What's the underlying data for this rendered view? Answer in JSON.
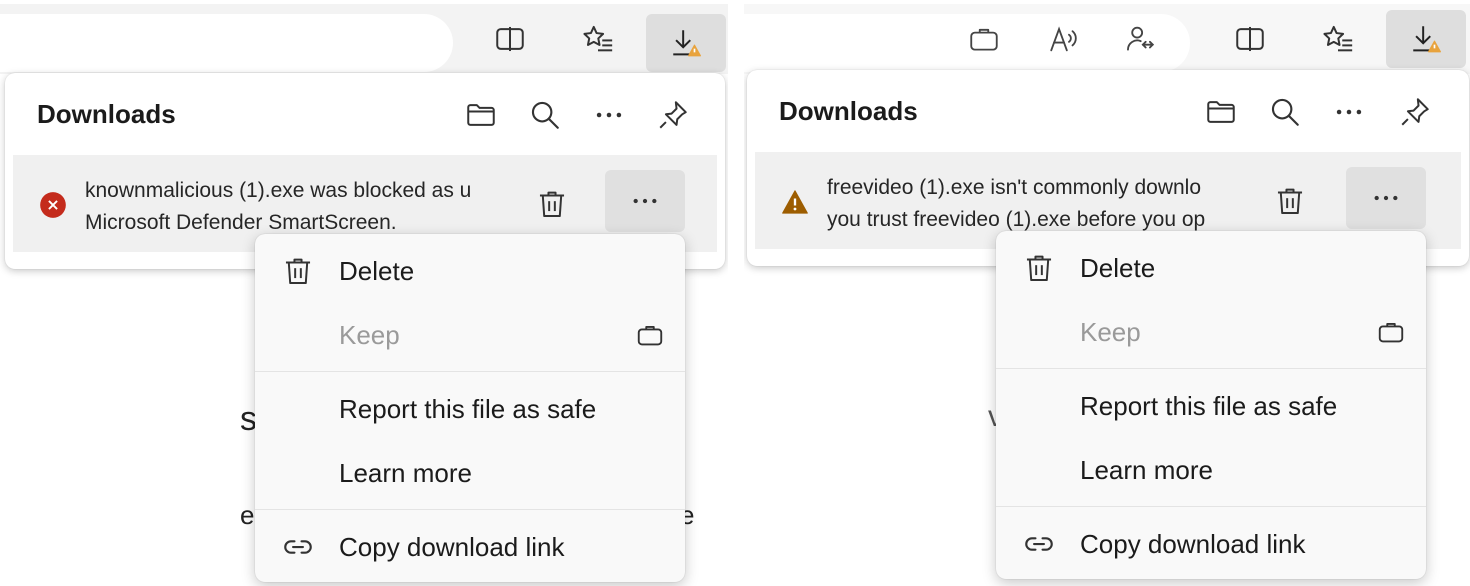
{
  "left": {
    "flyout_title": "Downloads",
    "item": {
      "status": "blocked",
      "status_icon": "error-circle-icon",
      "status_color": "#c42b1c",
      "line1": "knownmalicious (1).exe was blocked as u",
      "line2": "Microsoft Defender SmartScreen."
    },
    "background_fragments": [
      "s",
      "e",
      "e"
    ],
    "menu": {
      "delete": "Delete",
      "keep": "Keep",
      "report": "Report this file as safe",
      "learn": "Learn more",
      "copy": "Copy download link"
    }
  },
  "right": {
    "flyout_title": "Downloads",
    "item": {
      "status": "warning",
      "status_icon": "warning-triangle-icon",
      "status_color": "#9d5d00",
      "line1": "freevideo (1).exe isn't commonly downlo",
      "line2": "you trust freevideo (1).exe before you op"
    },
    "background_fragments": [
      "v"
    ],
    "menu": {
      "delete": "Delete",
      "keep": "Keep",
      "report": "Report this file as safe",
      "learn": "Learn more",
      "copy": "Copy download link"
    }
  },
  "colors": {
    "warning_badge": "#e8a33d",
    "menu_background": "#f9f9f9",
    "item_background": "#f0f0f0"
  }
}
